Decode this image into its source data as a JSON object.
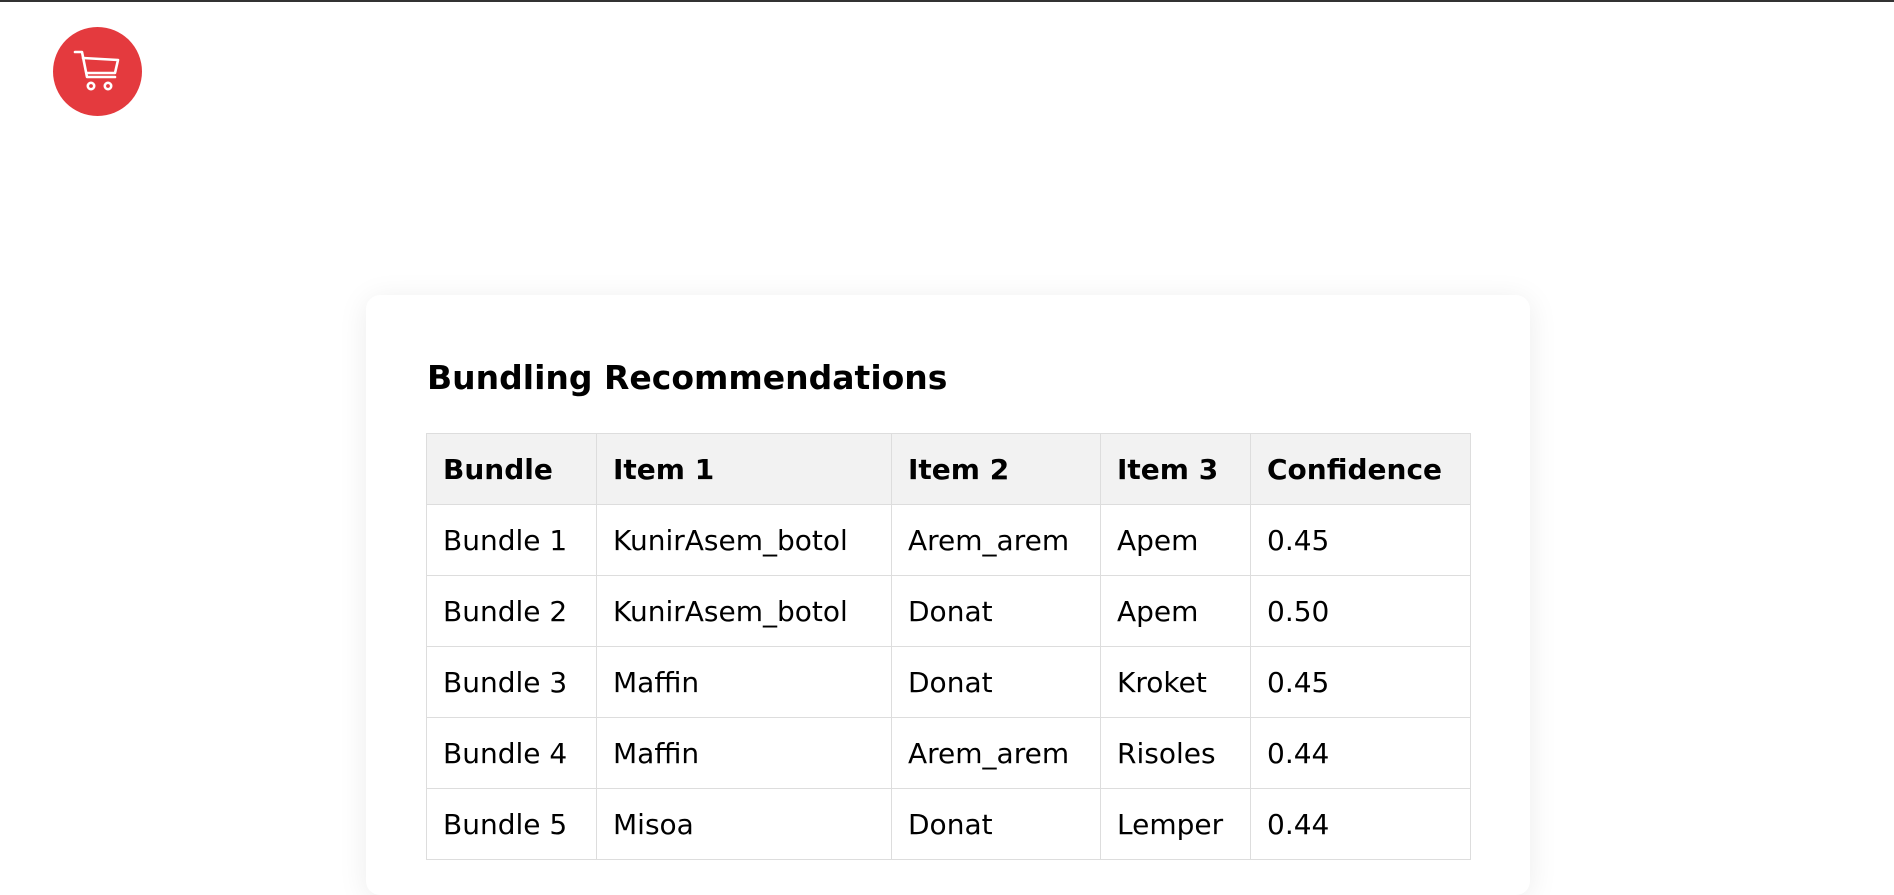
{
  "header": {
    "cart_icon": "shopping-cart-icon",
    "accent_color": "#e43a3e"
  },
  "card": {
    "title": "Bundling Recommendations"
  },
  "table": {
    "columns": [
      "Bundle",
      "Item 1",
      "Item 2",
      "Item 3",
      "Confidence"
    ],
    "rows": [
      [
        "Bundle 1",
        "KunirAsem_botol",
        "Arem_arem",
        "Apem",
        "0.45"
      ],
      [
        "Bundle 2",
        "KunirAsem_botol",
        "Donat",
        "Apem",
        "0.50"
      ],
      [
        "Bundle 3",
        "Maffin",
        "Donat",
        "Kroket",
        "0.45"
      ],
      [
        "Bundle 4",
        "Maffin",
        "Arem_arem",
        "Risoles",
        "0.44"
      ],
      [
        "Bundle 5",
        "Misoa",
        "Donat",
        "Lemper",
        "0.44"
      ]
    ]
  }
}
